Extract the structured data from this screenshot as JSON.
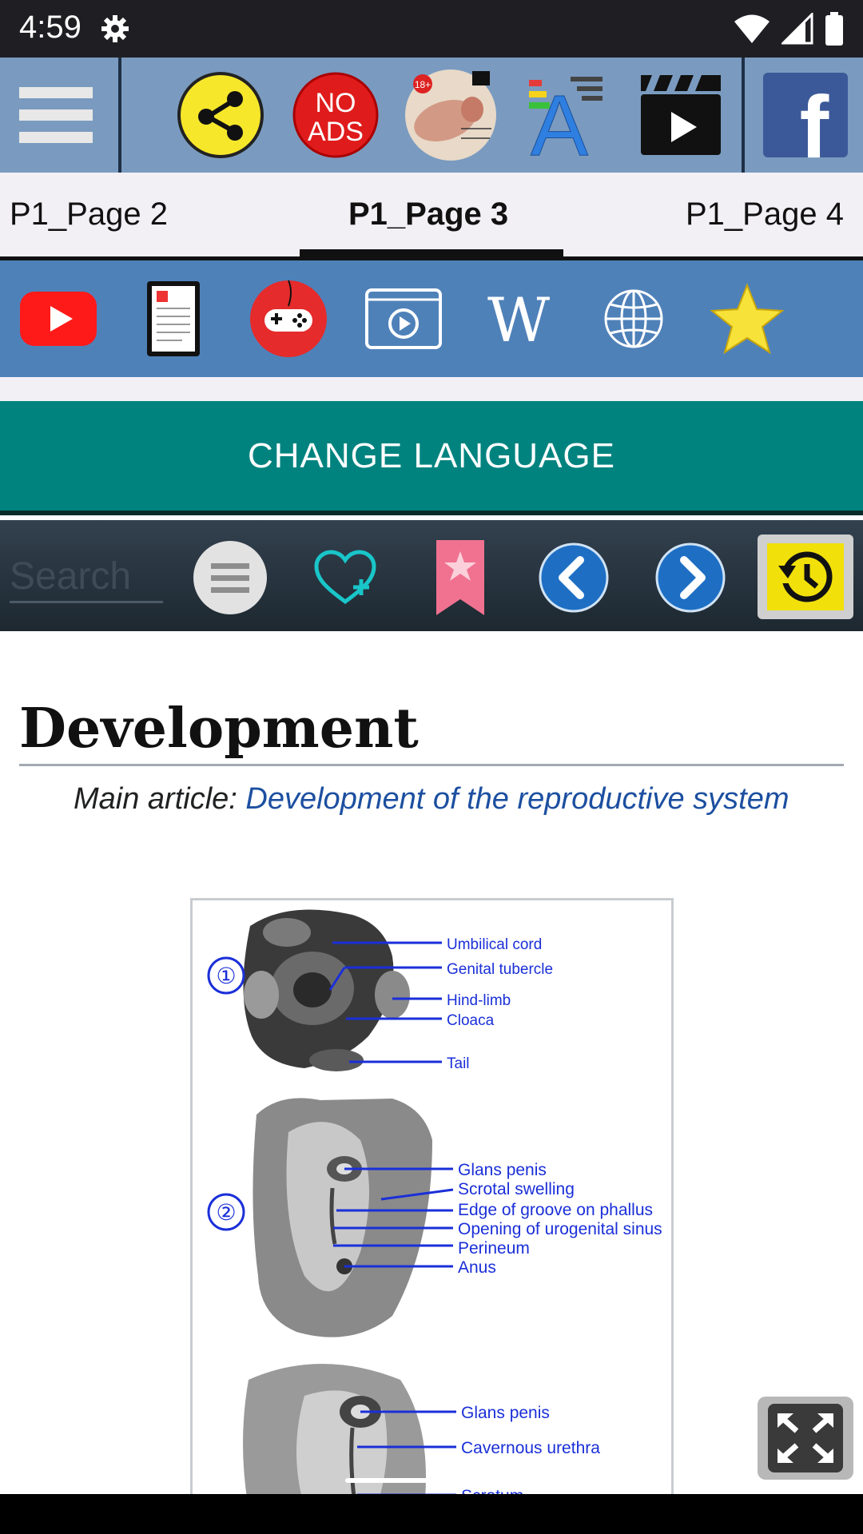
{
  "status_bar": {
    "time": "4:59",
    "icons": [
      "gear-icon",
      "wifi-icon",
      "signal-icon",
      "battery-icon"
    ]
  },
  "toolbar": {
    "buttons": [
      "menu-icon",
      "share-icon",
      "no-ads-icon",
      "anatomy-thumbnail-icon",
      "font-size-icon",
      "video-clapper-icon",
      "facebook-icon"
    ],
    "no_ads_line1": "NO",
    "no_ads_line2": "ADS",
    "anatomy_badge": "18+",
    "font_letter": "A",
    "facebook_letter": "f"
  },
  "tabs": {
    "items": [
      {
        "label": "P1_Page 2"
      },
      {
        "label": "P1_Page 3",
        "active": true
      },
      {
        "label": "P1_Page 4"
      }
    ]
  },
  "icon_strip": {
    "buttons": [
      "youtube-icon",
      "ebook-icon",
      "gamepad-icon",
      "video-player-icon",
      "wikipedia-icon",
      "globe-icon",
      "star-icon"
    ],
    "wiki_letter": "W"
  },
  "language_button": {
    "label": "CHANGE LANGUAGE"
  },
  "navbar": {
    "search_placeholder": "Search",
    "buttons": [
      "list-menu-icon",
      "favorite-add-icon",
      "bookmark-icon",
      "back-arrow-icon",
      "forward-arrow-icon",
      "history-icon"
    ]
  },
  "article": {
    "heading": "Development",
    "hatnote_prefix": "Main article: ",
    "hatnote_link": "Development of the reproductive system",
    "figure": {
      "stage1_number": "①",
      "stage2_number": "②",
      "stage1_labels": [
        "Umbilical cord",
        "Genital tubercle",
        "Hind-limb",
        "Cloaca",
        "Tail"
      ],
      "stage2_labels": [
        "Glans penis",
        "Scrotal swelling",
        "Edge of groove on phallus",
        "Opening of urogenital sinus",
        "Perineum",
        "Anus"
      ],
      "stage3_labels": [
        "Glans penis",
        "Cavernous urethra",
        "Scrotum"
      ]
    }
  },
  "colors": {
    "toolbar_bg": "#7a9bbf",
    "icon_strip_bg": "#4f81b9",
    "language_bg": "#00837f",
    "link": "#1c4fa0",
    "label_blue": "#1a2fd8"
  }
}
